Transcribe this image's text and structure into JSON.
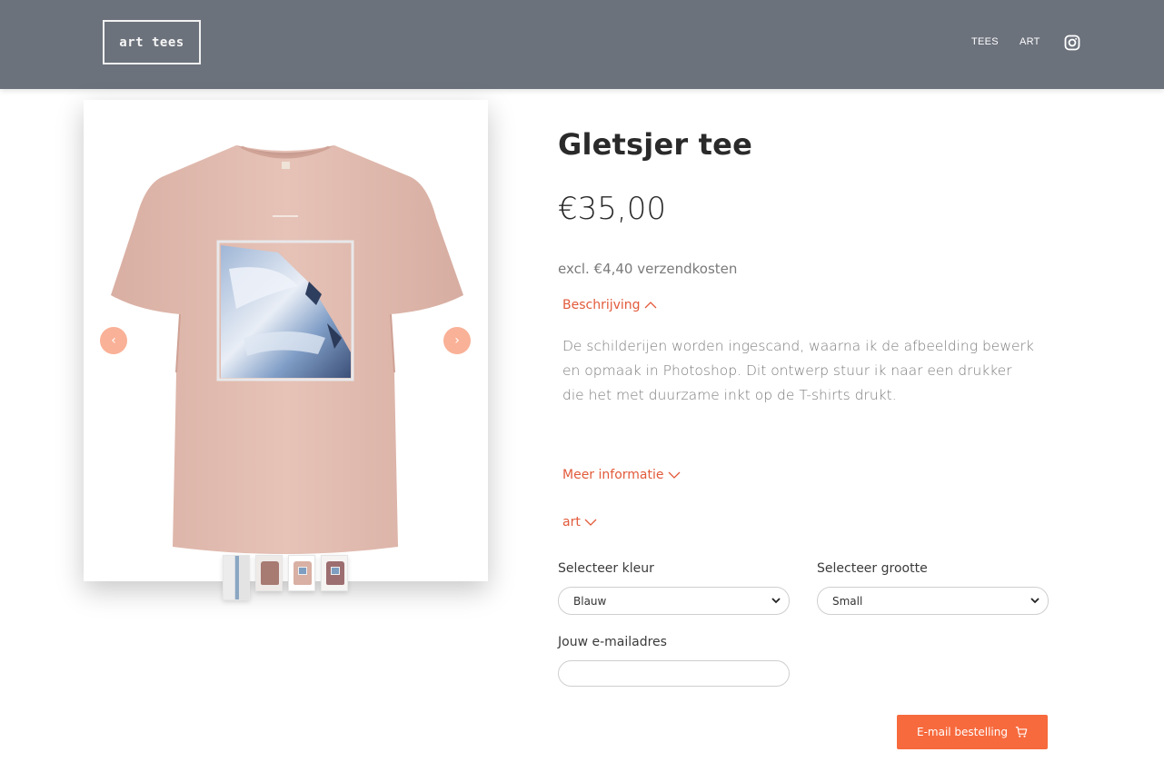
{
  "header": {
    "logo_text": "art tees",
    "nav": {
      "tees": "TEES",
      "art": "ART"
    },
    "instagram_icon": "instagram-icon"
  },
  "gallery": {
    "prev_icon": "chevron-left-icon",
    "next_icon": "chevron-right-icon",
    "thumbnail_count": 4,
    "shirt_color": "#e3bcb0"
  },
  "product": {
    "title": "Gletsjer tee",
    "price": "€35,00",
    "shipping": "excl. €4,40 verzendkosten",
    "description_toggle": "Beschrijving",
    "description": "De schilderijen worden ingescand, waarna ik de afbeelding bewerk en opmaak in Photoshop. Dit ontwerp stuur ik naar een drukker die het met duurzame inkt op de T-shirts drukt.",
    "more_info_toggle": "Meer informatie",
    "art_toggle": "art"
  },
  "form": {
    "color_label": "Selecteer kleur",
    "color_value": "Blauw",
    "size_label": "Selecteer grootte",
    "size_value": "Small",
    "email_label": "Jouw e-mailadres",
    "email_value": "",
    "order_button": "E-mail bestelling"
  },
  "colors": {
    "header_bg": "#6c727c",
    "accent": "#f76a3d",
    "link": "#e25a3a"
  }
}
